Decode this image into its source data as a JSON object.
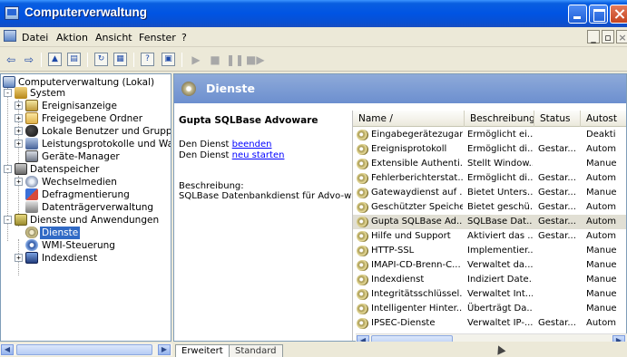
{
  "window": {
    "title": "Computerverwaltung"
  },
  "menu": {
    "items": [
      "Datei",
      "Aktion",
      "Ansicht",
      "Fenster",
      "?"
    ]
  },
  "tree": {
    "root": "Computerverwaltung (Lokal)",
    "system": "System",
    "event_viewer": "Ereignisanzeige",
    "shared_folders": "Freigegebene Ordner",
    "local_users": "Lokale Benutzer und Gruppe",
    "perf_logs": "Leistungsprotokolle und War",
    "device_manager": "Geräte-Manager",
    "storage": "Datenspeicher",
    "removable": "Wechselmedien",
    "defrag": "Defragmentierung",
    "disk_mgmt": "Datenträgerverwaltung",
    "services_apps": "Dienste und Anwendungen",
    "services": "Dienste",
    "wmi": "WMI-Steuerung",
    "index": "Indexdienst"
  },
  "header": {
    "title": "Dienste"
  },
  "detail": {
    "service_name": "Gupta SQLBase Advoware",
    "stop_prefix": "Den Dienst ",
    "stop_link": "beenden",
    "restart_prefix": "Den Dienst ",
    "restart_link": "neu starten",
    "description_label": "Beschreibung:",
    "description": "SQLBase Datenbankdienst für Advo-ware"
  },
  "list": {
    "columns": [
      "Name  /",
      "Beschreibung",
      "Status",
      "Autost"
    ],
    "rows": [
      [
        "Eingabegerätezugang",
        "Ermöglicht ei...",
        "",
        "Deakti"
      ],
      [
        "Ereignisprotokoll",
        "Ermöglicht di...",
        "Gestar...",
        "Autom"
      ],
      [
        "Extensible Authenti...",
        "Stellt Window...",
        "",
        "Manue"
      ],
      [
        "Fehlerberichterstat...",
        "Ermöglicht di...",
        "Gestar...",
        "Autom"
      ],
      [
        "Gatewaydienst auf ...",
        "Bietet Unters...",
        "Gestar...",
        "Manue"
      ],
      [
        "Geschützter Speicher",
        "Bietet geschü...",
        "Gestar...",
        "Autom"
      ],
      [
        "Gupta SQLBase Ad...",
        "SQLBase Dat...",
        "Gestar...",
        "Autom"
      ],
      [
        "Hilfe und Support",
        "Aktiviert das ...",
        "Gestar...",
        "Autom"
      ],
      [
        "HTTP-SSL",
        "Implementier...",
        "",
        "Manue"
      ],
      [
        "IMAPI-CD-Brenn-C...",
        "Verwaltet da...",
        "",
        "Manue"
      ],
      [
        "Indexdienst",
        "Indiziert Date...",
        "",
        "Manue"
      ],
      [
        "Integritätsschlüssel...",
        "Verwaltet Int...",
        "",
        "Manue"
      ],
      [
        "Intelligenter Hinter...",
        "Überträgt Da...",
        "",
        "Manue"
      ],
      [
        "IPSEC-Dienste",
        "Verwaltet IP-...",
        "Gestar...",
        "Autom"
      ]
    ],
    "selected_row": 6
  },
  "tabs": [
    "Erweitert",
    "Standard"
  ]
}
